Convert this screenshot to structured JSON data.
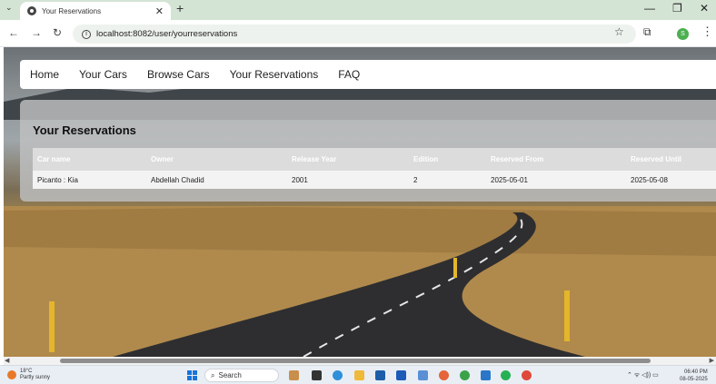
{
  "browser": {
    "tab_title": "Your Reservations",
    "tab_close": "✕",
    "new_tab": "+",
    "url": "localhost:8082/user/yourreservations",
    "profile_initial": "S",
    "window_controls": [
      "—",
      "❐",
      "✕"
    ]
  },
  "nav": {
    "items": [
      "Home",
      "Your Cars",
      "Browse Cars",
      "Your Reservations",
      "FAQ"
    ]
  },
  "page": {
    "heading": "Your Reservations"
  },
  "table": {
    "headers": [
      "Car name",
      "Owner",
      "Release Year",
      "Edition",
      "Reserved From",
      "Reserved Until"
    ],
    "rows": [
      [
        "Picanto : Kia",
        "Abdellah Chadid",
        "2001",
        "2",
        "2025-05-01",
        "2025-05-08"
      ]
    ]
  },
  "taskbar": {
    "weather_temp": "18°C",
    "weather_desc": "Partly sunny",
    "search_label": "Search",
    "clock_time": "06:40 PM",
    "clock_date": "08-05-2025"
  },
  "colors": {
    "accent_green": "#4caf50",
    "windows_blue": "#1a73d9"
  }
}
